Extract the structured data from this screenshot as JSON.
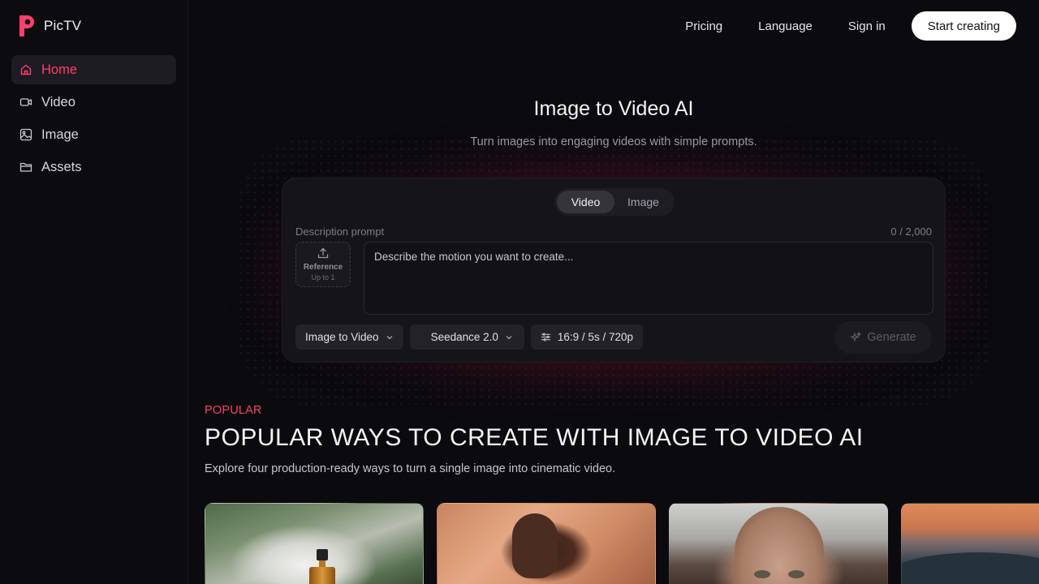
{
  "brand": {
    "name": "PicTV",
    "accent": "#ff3f6c"
  },
  "sidebar": {
    "items": [
      {
        "label": "Home",
        "icon": "home-icon",
        "active": true
      },
      {
        "label": "Video",
        "icon": "video-camera-icon",
        "active": false
      },
      {
        "label": "Image",
        "icon": "image-icon",
        "active": false
      },
      {
        "label": "Assets",
        "icon": "folder-icon",
        "active": false
      }
    ]
  },
  "header": {
    "links": [
      "Pricing",
      "Language",
      "Sign in"
    ],
    "cta": "Start creating"
  },
  "hero": {
    "title": "Image to Video AI",
    "subtitle": "Turn images into engaging videos with simple prompts."
  },
  "composer": {
    "tabs": [
      {
        "label": "Video",
        "active": true
      },
      {
        "label": "Image",
        "active": false
      }
    ],
    "prompt_label": "Description prompt",
    "counter": "0 / 2,000",
    "reference_label": "Reference",
    "reference_sub": "Up to 1",
    "prompt_placeholder": "Describe the motion you want to create...",
    "mode": "Image to Video",
    "model": "Seedance 2.0",
    "settings": "16:9 / 5s / 720p",
    "generate": "Generate"
  },
  "popular": {
    "kicker": "POPULAR",
    "title": "POPULAR WAYS TO CREATE WITH IMAGE TO VIDEO AI",
    "subtitle": "Explore four production-ready ways to turn a single image into cinematic video.",
    "cards": [
      {
        "subject": "perfume bottle"
      },
      {
        "subject": "woman portrait"
      },
      {
        "subject": "face close-up"
      },
      {
        "subject": "mountain landscape"
      }
    ]
  }
}
